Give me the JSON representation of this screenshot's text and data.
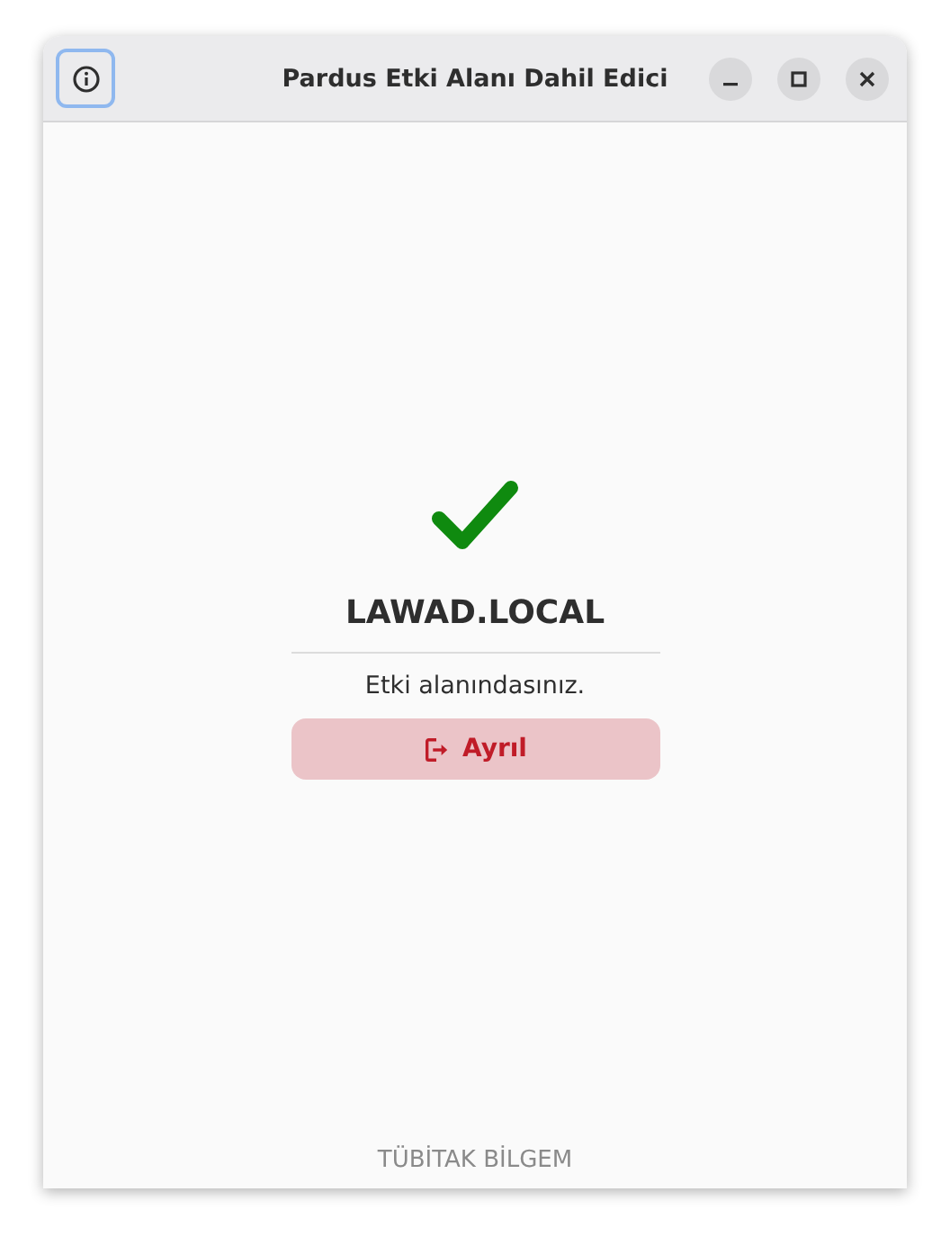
{
  "window": {
    "title": "Pardus Etki Alanı Dahil Edici",
    "info_button_focused": true
  },
  "status": {
    "kind": "joined",
    "domain": "LAWAD.LOCAL",
    "message": "Etki alanındasınız."
  },
  "leave_button": {
    "label": "Ayrıl"
  },
  "footer": "TÜBİTAK BİLGEM"
}
